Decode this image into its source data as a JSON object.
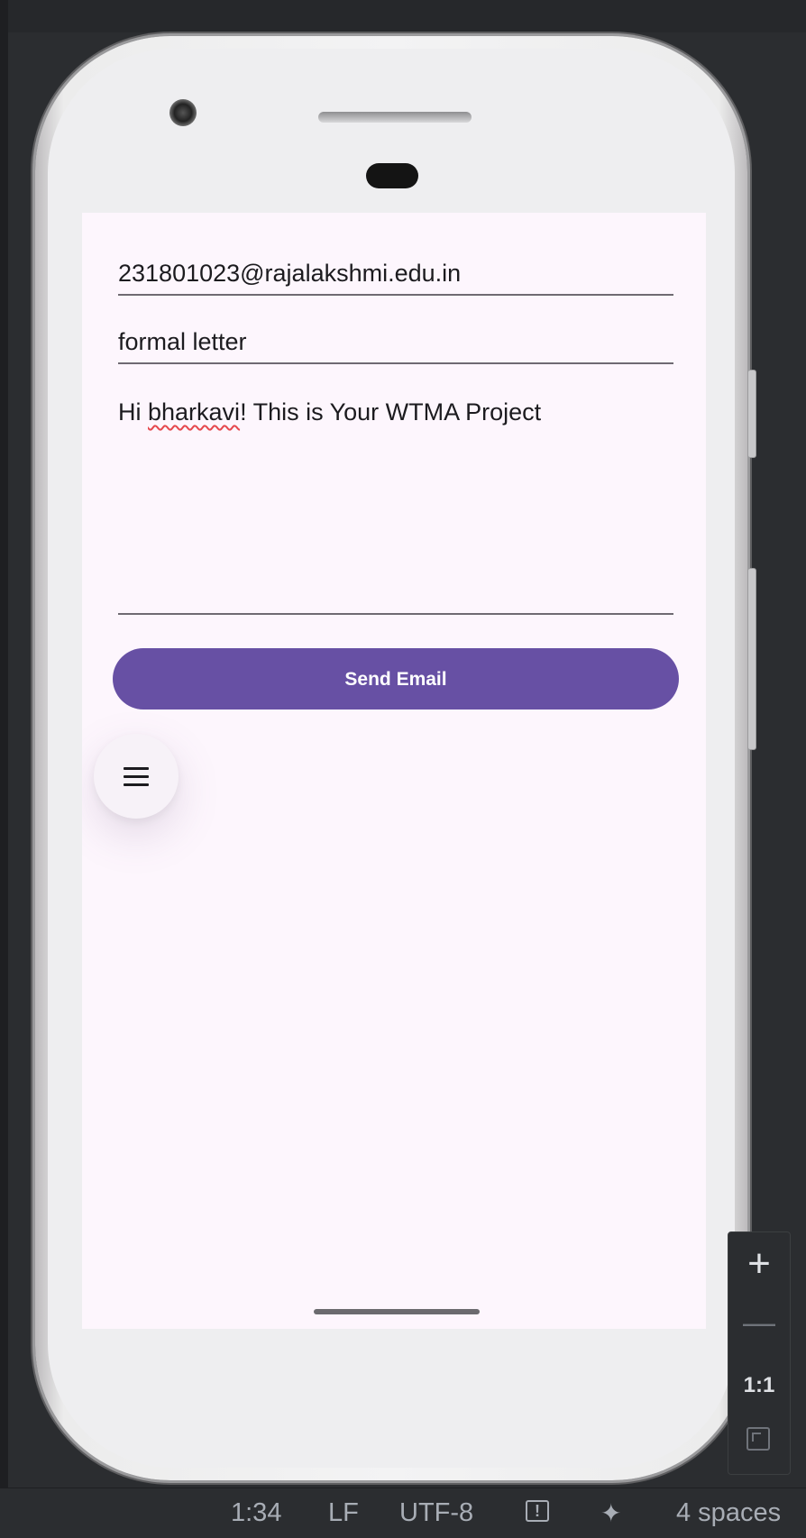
{
  "email_form": {
    "to_value": "231801023@rajalakshmi.edu.in",
    "subject_value": "formal letter",
    "message_prefix": "Hi ",
    "message_flagged_word": "bharkavi",
    "message_suffix": "! This is Your WTMA Project"
  },
  "send_button": {
    "label": "Send Email",
    "color": "#6750a4"
  },
  "fab": {
    "icon": "menu-icon"
  },
  "emulator_zoom": {
    "zoom_in": "+",
    "zoom_out": "—",
    "actual_size": "1:1",
    "fit_icon": "fit-screen-icon"
  },
  "ide_status": {
    "cursor_position": "1:34",
    "line_separator": "LF",
    "encoding": "UTF-8",
    "warning_icon": "!",
    "ai_icon": "✦",
    "indent": "4 spaces"
  }
}
